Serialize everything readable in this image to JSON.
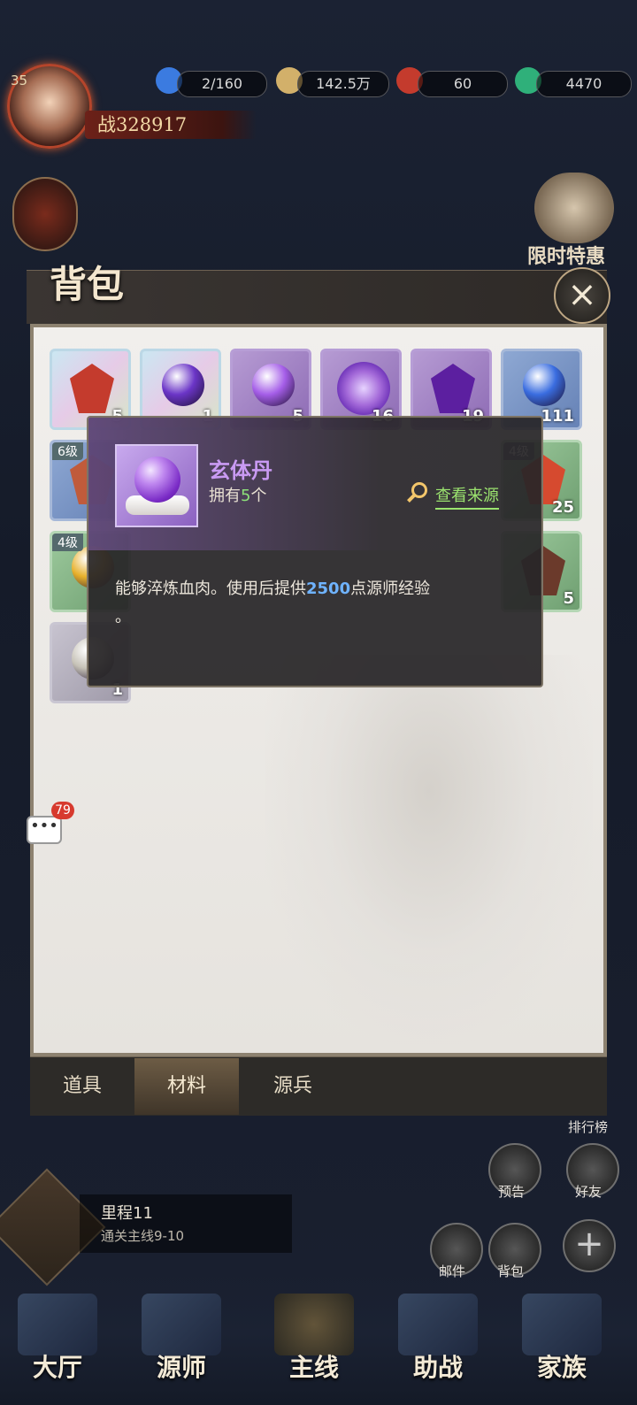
{
  "player": {
    "level": "35",
    "power": "战328917"
  },
  "resources": [
    {
      "name": "stamina",
      "value": "2/160",
      "icon": "drop-icon",
      "color": "#3b7be0"
    },
    {
      "name": "gold",
      "value": "142.5万",
      "icon": "coin-icon",
      "color": "#d2b06a"
    },
    {
      "name": "gem",
      "value": "60",
      "icon": "red-gem-icon",
      "color": "#c43b2d"
    },
    {
      "name": "jade",
      "value": "4470",
      "icon": "green-gem-icon",
      "color": "#2fb07a"
    }
  ],
  "limited": {
    "label": "限时特惠"
  },
  "bag": {
    "title": "背包",
    "close_icon": "×",
    "items": [
      {
        "type": "rainbow",
        "icon": "crystal",
        "count": "5",
        "color": "#c43b2d"
      },
      {
        "type": "rainbow",
        "icon": "orb",
        "count": "1",
        "color": "#6b35c7"
      },
      {
        "type": "purple",
        "icon": "orb",
        "count": "5",
        "color": "#a55ee8"
      },
      {
        "type": "purple",
        "icon": "flower",
        "count": "16",
        "color": "#8a4bd1"
      },
      {
        "type": "purple",
        "icon": "crystal",
        "count": "19",
        "color": "#5c1fa0"
      },
      {
        "type": "blue",
        "icon": "orb",
        "count": "111",
        "color": "#3a6de0"
      },
      {
        "type": "blue",
        "level": "6级",
        "icon": "crystal",
        "count": "",
        "color": "#c05b3b"
      },
      {
        "type": "green",
        "level": "4级",
        "icon": "crystal",
        "count": "25",
        "color": "#d64a2f"
      },
      {
        "type": "green",
        "level": "4级",
        "icon": "orb",
        "count": "",
        "color": "#e7b02b"
      },
      {
        "type": "green",
        "icon": "crystal",
        "count": "5",
        "color": "#6b3a2b"
      },
      {
        "type": "grey",
        "icon": "orb",
        "count": "1",
        "color": "#c6c2b7"
      }
    ]
  },
  "tooltip": {
    "name": "玄体丹",
    "own_prefix": "拥有",
    "own_count": "5",
    "own_suffix": "个",
    "source": "查看来源",
    "desc_pre": "能够淬炼血肉。使用后提供",
    "desc_num": "2500",
    "desc_post": "点源师经验",
    "desc_end": "。"
  },
  "chat": {
    "icon": "•••",
    "badge": "79"
  },
  "tabs": [
    {
      "label": "道具"
    },
    {
      "label": "材料"
    },
    {
      "label": "源兵"
    }
  ],
  "side": {
    "notice": "预告",
    "friends": "好友",
    "mail": "邮件",
    "bag": "背包",
    "rank": "排行榜",
    "plus": "+"
  },
  "quest": {
    "title": "里程11",
    "subtitle": "通关主线9-10"
  },
  "nav": [
    {
      "label": "大厅"
    },
    {
      "label": "源师"
    },
    {
      "label": "主线"
    },
    {
      "label": "助战"
    },
    {
      "label": "家族"
    }
  ]
}
